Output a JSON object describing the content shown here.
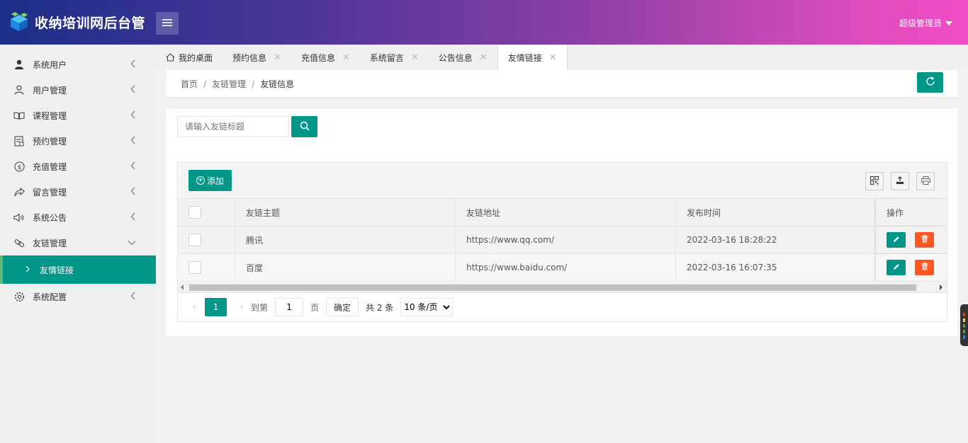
{
  "app": {
    "title": "收纳培训网后台管"
  },
  "header": {
    "user_name": "超级管理员"
  },
  "sidebar": {
    "items": [
      {
        "label": "系统用户",
        "icon": "user-solid-icon"
      },
      {
        "label": "用户管理",
        "icon": "user-outline-icon"
      },
      {
        "label": "课程管理",
        "icon": "book-icon"
      },
      {
        "label": "预约管理",
        "icon": "calendar-doc-icon"
      },
      {
        "label": "充值管理",
        "icon": "dollar-icon"
      },
      {
        "label": "留言管理",
        "icon": "share-icon"
      },
      {
        "label": "系统公告",
        "icon": "speaker-icon"
      },
      {
        "label": "友链管理",
        "icon": "link-icon"
      },
      {
        "label": "系统配置",
        "icon": "gear-icon"
      }
    ],
    "active_sub": {
      "label": "友情链接"
    }
  },
  "tabs": [
    {
      "label": "我的桌面",
      "closable": false
    },
    {
      "label": "预约信息",
      "closable": true
    },
    {
      "label": "充值信息",
      "closable": true
    },
    {
      "label": "系统留言",
      "closable": true
    },
    {
      "label": "公告信息",
      "closable": true
    },
    {
      "label": "友情链接",
      "closable": true,
      "active": true
    }
  ],
  "breadcrumb": {
    "home": "首页",
    "section": "友链管理",
    "current": "友链信息"
  },
  "search": {
    "placeholder": "请输入友链标题"
  },
  "toolbar": {
    "add_label": "添加"
  },
  "table": {
    "headers": [
      "友链主题",
      "友链地址",
      "发布时间",
      "操作"
    ],
    "rows": [
      {
        "title": "腾讯",
        "url": "https://www.qq.com/",
        "time": "2022-03-16 18:28:22"
      },
      {
        "title": "百度",
        "url": "https://www.baidu.com/",
        "time": "2022-03-16 16:07:35"
      }
    ]
  },
  "pager": {
    "current": "1",
    "goto_label": "到第",
    "goto_value": "1",
    "page_label": "页",
    "confirm_label": "确定",
    "total": "共 2 条",
    "page_size": "10 条/页"
  },
  "colors": {
    "primary": "#009688",
    "danger": "#ff5722",
    "header_start": "#1c2f88",
    "header_end": "#f24dc4"
  }
}
